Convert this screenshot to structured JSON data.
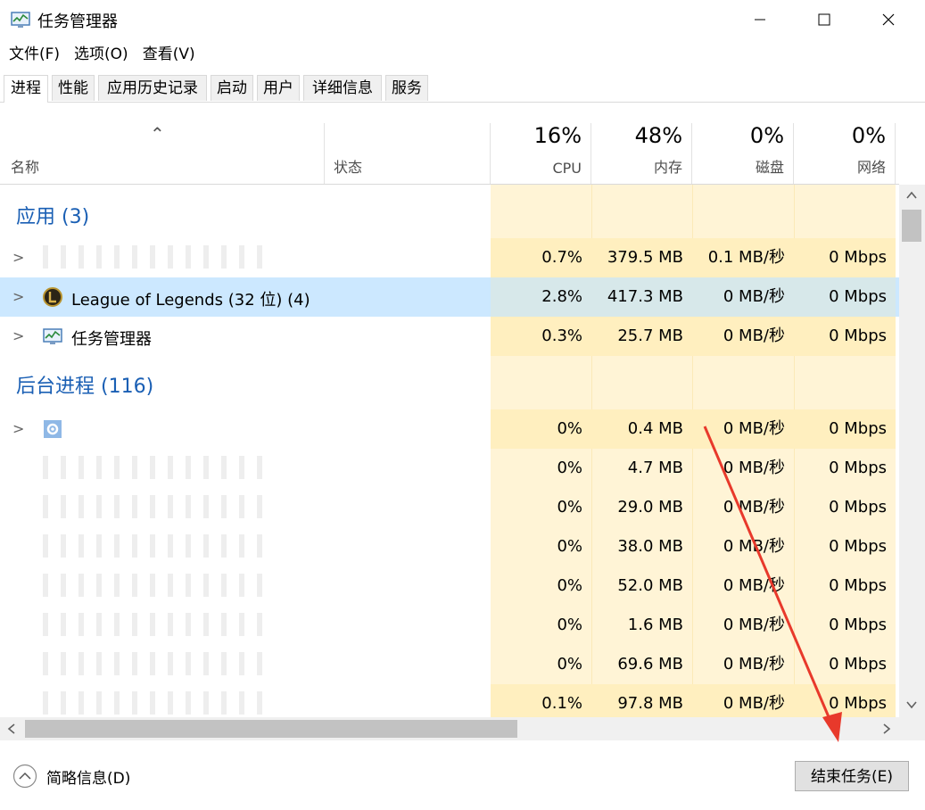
{
  "window": {
    "title": "任务管理器",
    "minimize": "—",
    "maximize": "☐",
    "close": "✕"
  },
  "menu": [
    "文件(F)",
    "选项(O)",
    "查看(V)"
  ],
  "tabs": [
    "进程",
    "性能",
    "应用历史记录",
    "启动",
    "用户",
    "详细信息",
    "服务"
  ],
  "header": {
    "name": "名称",
    "status": "状态",
    "cpu": {
      "pct": "16%",
      "label": "CPU"
    },
    "mem": {
      "pct": "48%",
      "label": "内存"
    },
    "disk": {
      "pct": "0%",
      "label": "磁盘"
    },
    "net": {
      "pct": "0%",
      "label": "网络"
    }
  },
  "groups": {
    "apps": "应用 (3)",
    "background": "后台进程 (116)"
  },
  "apps": [
    {
      "name": "",
      "cpu": "0.7%",
      "mem": "379.5 MB",
      "disk": "0.1 MB/秒",
      "net": "0 Mbps",
      "icon": "blurred-icon"
    },
    {
      "name": "League of Legends (32 位) (4)",
      "cpu": "2.8%",
      "mem": "417.3 MB",
      "disk": "0 MB/秒",
      "net": "0 Mbps",
      "icon": "league-icon"
    },
    {
      "name": "任务管理器",
      "cpu": "0.3%",
      "mem": "25.7 MB",
      "disk": "0 MB/秒",
      "net": "0 Mbps",
      "icon": "task-manager-icon"
    }
  ],
  "background": [
    {
      "cpu": "0%",
      "mem": "0.4 MB",
      "disk": "0 MB/秒",
      "net": "0 Mbps"
    },
    {
      "cpu": "0%",
      "mem": "4.7 MB",
      "disk": "0 MB/秒",
      "net": "0 Mbps"
    },
    {
      "cpu": "0%",
      "mem": "29.0 MB",
      "disk": "0 MB/秒",
      "net": "0 Mbps"
    },
    {
      "cpu": "0%",
      "mem": "38.0 MB",
      "disk": "0 MB/秒",
      "net": "0 Mbps"
    },
    {
      "cpu": "0%",
      "mem": "52.0 MB",
      "disk": "0 MB/秒",
      "net": "0 Mbps"
    },
    {
      "cpu": "0%",
      "mem": "1.6 MB",
      "disk": "0 MB/秒",
      "net": "0 Mbps"
    },
    {
      "cpu": "0%",
      "mem": "69.6 MB",
      "disk": "0 MB/秒",
      "net": "0 Mbps"
    },
    {
      "cpu": "0.1%",
      "mem": "97.8 MB",
      "disk": "0 MB/秒",
      "net": "0 Mbps"
    }
  ],
  "footer": {
    "fewer_details": "简略信息(D)",
    "end_task": "结束任务(E)"
  },
  "colors": {
    "heat_light": "#fff4d6",
    "heat_mid": "#ffefbf",
    "selected": "#cce8ff",
    "group_text": "#1a5fb4",
    "arrow": "#e8392b"
  }
}
